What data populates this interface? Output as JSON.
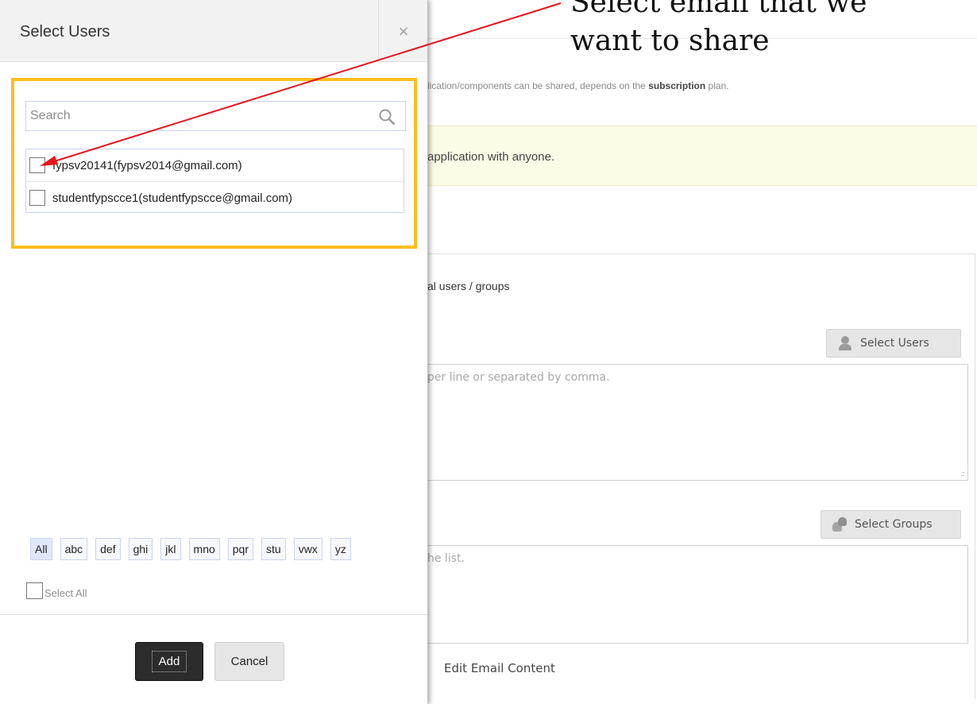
{
  "background": {
    "info_prefix": "lication/components can be shared, depends on the ",
    "info_bold": "subscription",
    "info_suffix": " plan.",
    "warning_text": "application with anyone.",
    "section_title": "al users / groups",
    "select_users_label": "Select Users",
    "users_textarea_placeholder": "per line or separated by comma.",
    "select_groups_label": "Select Groups",
    "groups_textarea_placeholder": "he list.",
    "edit_email_label": "Edit Email Content"
  },
  "modal": {
    "title": "Select Users",
    "close_glyph": "×",
    "search_placeholder": "Search",
    "users": [
      {
        "label": "fypsv20141(fypsv2014@gmail.com)",
        "checked": false
      },
      {
        "label": "studentfypscce1(studentfypscce@gmail.com)",
        "checked": false
      }
    ],
    "letter_filters": [
      "All",
      "abc",
      "def",
      "ghi",
      "jkl",
      "mno",
      "pqr",
      "stu",
      "vwx",
      "yz"
    ],
    "select_all_label": "Select All",
    "add_label": "Add",
    "cancel_label": "Cancel"
  },
  "annotation": {
    "line1": "Select email that we",
    "line2": "want to share",
    "arrow_color": "#e8141b",
    "highlight_color": "#fcbf20"
  },
  "icons": {
    "search": "search-icon",
    "user": "user-icon",
    "group": "group-icon",
    "close": "close-icon"
  }
}
